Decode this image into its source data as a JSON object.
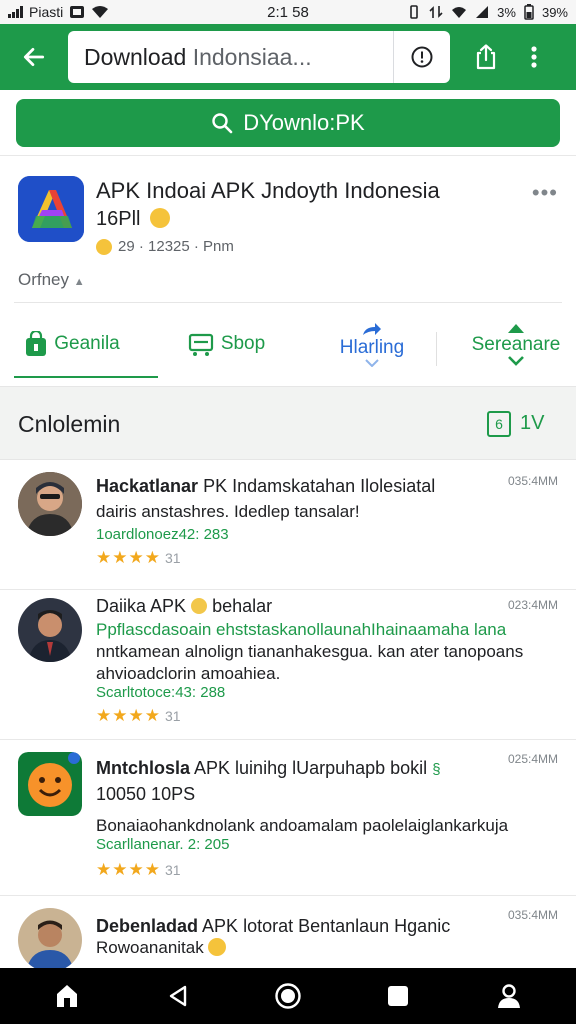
{
  "status_bar": {
    "carrier": "Piasti",
    "time": "2:1 58",
    "battery_pct": "3%",
    "battery_label": "39%"
  },
  "app_bar": {
    "url_bold": "Download",
    "url_light": "Indonsiaa..."
  },
  "download_button": {
    "label": "DYownlo:PK"
  },
  "app": {
    "title": "APK Indoai APK Jndoyth Indonesia",
    "subtitle": "16Pll",
    "meta": "29 · 12325 · Pnm",
    "developer": "Orfney"
  },
  "tabs": [
    {
      "label": "Geanila"
    },
    {
      "label": "Sbop"
    },
    {
      "label": "Hlarling"
    },
    {
      "label": "Sereanare"
    }
  ],
  "section": {
    "title": "Cnlolemin",
    "count": "6",
    "count_label": "1V"
  },
  "reviews": [
    {
      "name_bold": "Hackatlanar",
      "name_rest": "PK Indamskatahan Ilolesiatal",
      "line2": "dairis anstashres. Idedlep tansalar!",
      "meta": "1oardlonoez42: 283",
      "time": "035:4MM",
      "stars": "★★★★",
      "star_count": "31"
    },
    {
      "name_bold": "Daiika APK",
      "name_rest": "behalar",
      "line2": "Ppflascdasoain ehststaskanollaunahIhainaamaha lana",
      "line3": "nntkamean alnolign tiananhakesgua. kan ater tanopoans",
      "line4": "ahvioadclorin amoahiea.",
      "meta": "Scarltotoce:43: 288",
      "time": "023:4MM",
      "stars": "★★★★",
      "star_count": "31"
    },
    {
      "name_bold": "Mntchlosla",
      "name_rest": "APK luinihg lUarpuhapb bokil",
      "line2": "10050 10PS",
      "line3": "Bonaiaohankdnolank andoamalam paolelaiglankarkuja",
      "meta": "Scarllanenar. 2: 205",
      "time": "025:4MM",
      "stars": "★★★★",
      "star_count": "31"
    },
    {
      "name_bold": "Debenladad",
      "name_rest": "APK lotorat Bentanlaun Hganic",
      "line2": "Rowoananitak",
      "time": "035:4MM"
    }
  ]
}
